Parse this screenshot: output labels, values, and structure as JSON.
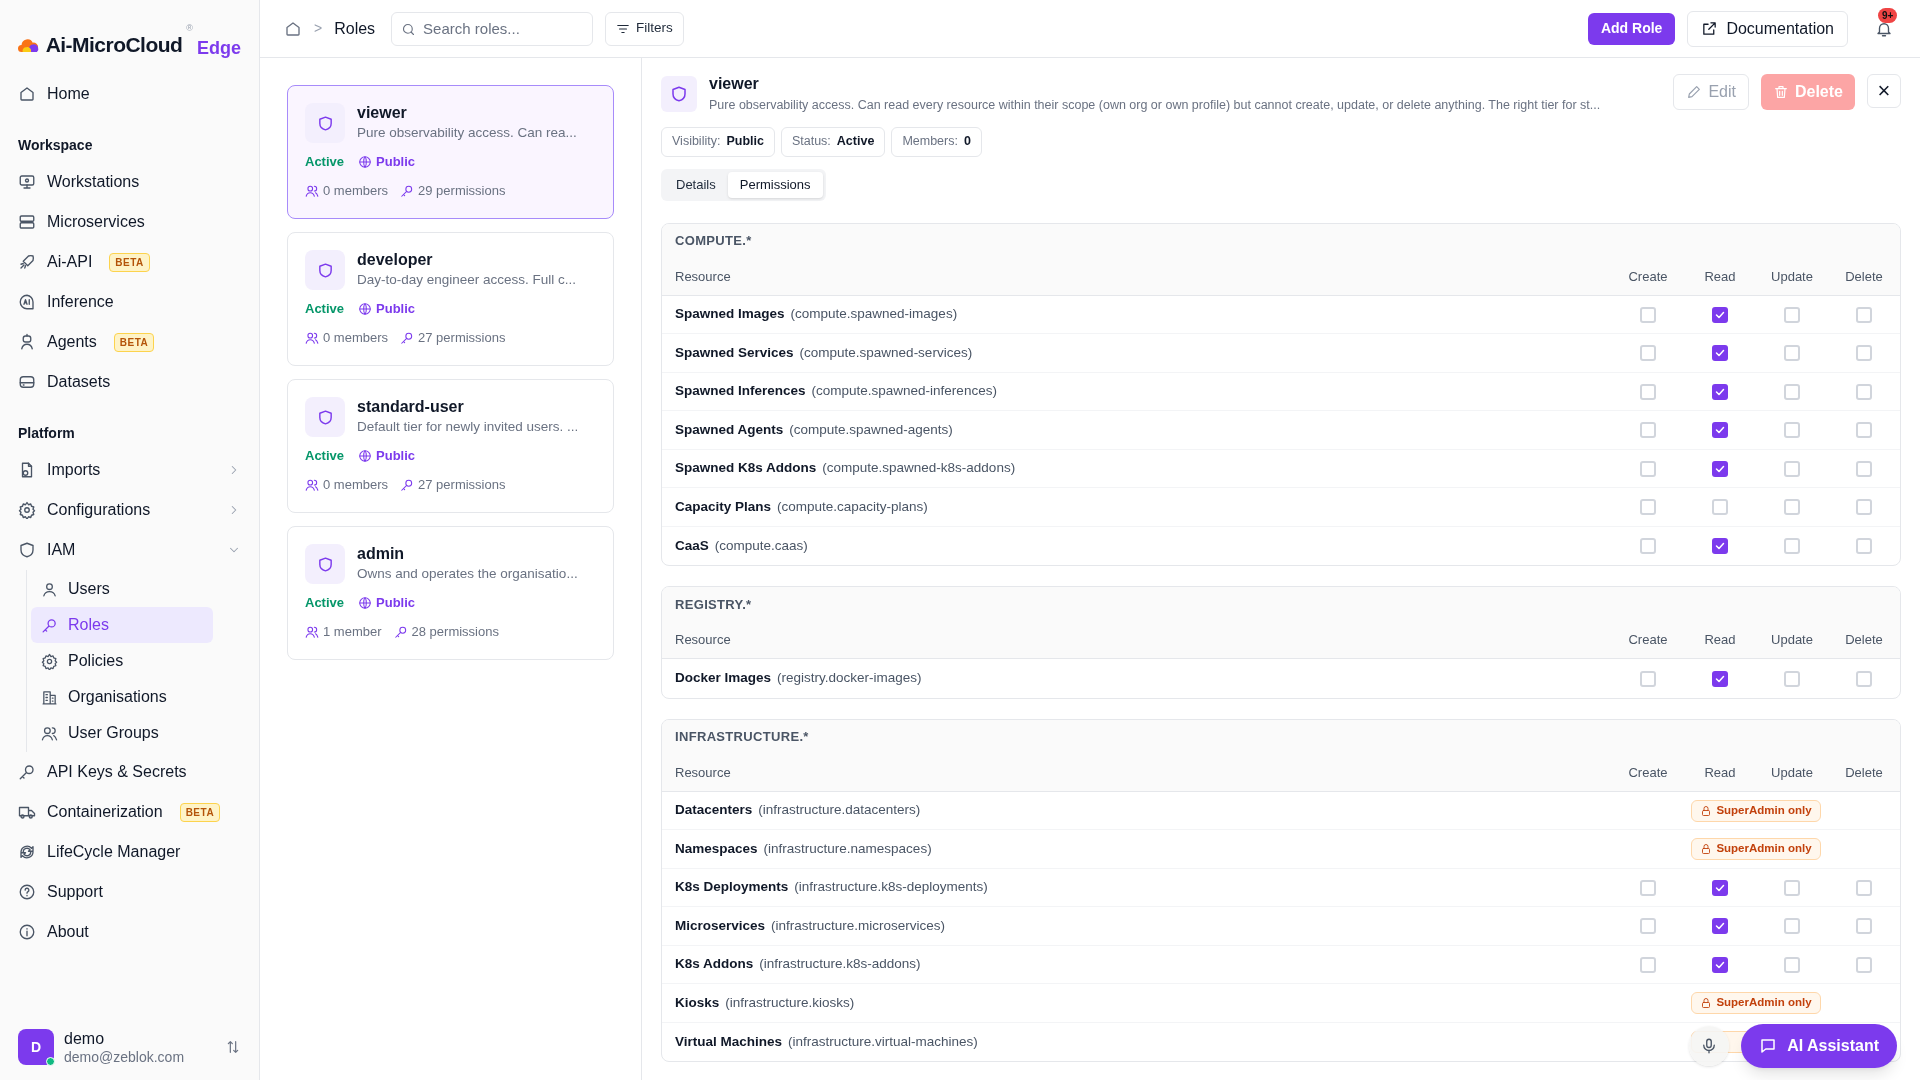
{
  "sidebar": {
    "brand": {
      "name": "Ai-MicroCloud",
      "mark": "®",
      "edition": "Edge"
    },
    "nav": [
      {
        "kind": "item",
        "label": "Home",
        "selected": false
      },
      {
        "kind": "section",
        "label": "Workspace"
      },
      {
        "kind": "item",
        "label": "Workstations",
        "selected": false
      },
      {
        "kind": "item",
        "label": "Microservices",
        "selected": false
      },
      {
        "kind": "item",
        "label": "Ai-API",
        "badge": "BETA",
        "selected": false
      },
      {
        "kind": "item",
        "label": "Inference",
        "selected": false
      },
      {
        "kind": "item",
        "label": "Agents",
        "badge": "BETA",
        "selected": false
      },
      {
        "kind": "item",
        "label": "Datasets",
        "selected": false
      },
      {
        "kind": "section",
        "label": "Platform"
      },
      {
        "kind": "group",
        "label": "Imports",
        "expanded": false
      },
      {
        "kind": "group",
        "label": "Configurations",
        "expanded": false
      },
      {
        "kind": "group",
        "label": "IAM",
        "expanded": true,
        "children": [
          {
            "label": "Users",
            "selected": false
          },
          {
            "label": "Roles",
            "selected": true
          },
          {
            "label": "Policies",
            "selected": false
          },
          {
            "label": "Organisations",
            "selected": false
          },
          {
            "label": "User Groups",
            "selected": false
          }
        ]
      },
      {
        "kind": "item",
        "label": "API Keys & Secrets",
        "selected": false
      },
      {
        "kind": "item",
        "label": "Containerization",
        "badge": "BETA",
        "selected": false
      },
      {
        "kind": "item",
        "label": "LifeCycle Manager",
        "selected": false
      },
      {
        "kind": "item",
        "label": "Support",
        "selected": false
      },
      {
        "kind": "item",
        "label": "About",
        "selected": false
      }
    ],
    "user": {
      "initial": "D",
      "name": "demo",
      "email": "demo@zeblok.com",
      "online": true
    }
  },
  "header": {
    "breadcrumb": ">",
    "page": "Roles",
    "search": {
      "placeholder": "Search roles..."
    },
    "filters": "Filters",
    "add_button": "Add Role",
    "docs_button": "Documentation",
    "notifications": "9+"
  },
  "roles": [
    {
      "name": "viewer",
      "description": "Pure observability access. Can rea...",
      "status": "Active",
      "visibility": "Public",
      "members": "0 members",
      "permissions": "29 permissions",
      "selected": true
    },
    {
      "name": "developer",
      "description": "Day-to-day engineer access. Full c...",
      "status": "Active",
      "visibility": "Public",
      "members": "0 members",
      "permissions": "27 permissions",
      "selected": false
    },
    {
      "name": "standard-user",
      "description": "Default tier for newly invited users. ...",
      "status": "Active",
      "visibility": "Public",
      "members": "0 members",
      "permissions": "27 permissions",
      "selected": false
    },
    {
      "name": "admin",
      "description": "Owns and operates the organisatio...",
      "status": "Active",
      "visibility": "Public",
      "members": "1 member",
      "permissions": "28 permissions",
      "selected": false
    }
  ],
  "detail": {
    "title": "viewer",
    "description": "Pure observability access. Can read every resource within their scope (own org or own profile) but cannot create, update, or delete anything. The right tier for st...",
    "edit": {
      "label": "Edit",
      "disabled": true
    },
    "delete": {
      "label": "Delete",
      "disabled": true
    },
    "close": "×",
    "chips": [
      {
        "label": "Visibility:",
        "value": "Public"
      },
      {
        "label": "Status:",
        "value": "Active"
      },
      {
        "label": "Members:",
        "value": "0"
      }
    ],
    "tabs": [
      {
        "label": "Details",
        "selected": false
      },
      {
        "label": "Permissions",
        "selected": true
      }
    ]
  },
  "permissions": [
    {
      "title": "COMPUTE.*",
      "columns": [
        "Resource",
        "Create",
        "Read",
        "Update",
        "Delete"
      ],
      "rows": [
        {
          "kind": "checks",
          "name": "Spawned Images",
          "key": "(compute.spawned-images)",
          "create": false,
          "read": true,
          "update": false,
          "delete": false
        },
        {
          "kind": "checks",
          "name": "Spawned Services",
          "key": "(compute.spawned-services)",
          "create": false,
          "read": true,
          "update": false,
          "delete": false
        },
        {
          "kind": "checks",
          "name": "Spawned Inferences",
          "key": "(compute.spawned-inferences)",
          "create": false,
          "read": true,
          "update": false,
          "delete": false
        },
        {
          "kind": "checks",
          "name": "Spawned Agents",
          "key": "(compute.spawned-agents)",
          "create": false,
          "read": true,
          "update": false,
          "delete": false
        },
        {
          "kind": "checks",
          "name": "Spawned K8s Addons",
          "key": "(compute.spawned-k8s-addons)",
          "create": false,
          "read": true,
          "update": false,
          "delete": false
        },
        {
          "kind": "checks",
          "name": "Capacity Plans",
          "key": "(compute.capacity-plans)",
          "create": false,
          "read": false,
          "update": false,
          "delete": false
        },
        {
          "kind": "checks",
          "name": "CaaS",
          "key": "(compute.caas)",
          "create": false,
          "read": true,
          "update": false,
          "delete": false
        }
      ]
    },
    {
      "title": "REGISTRY.*",
      "columns": [
        "Resource",
        "Create",
        "Read",
        "Update",
        "Delete"
      ],
      "rows": [
        {
          "kind": "checks",
          "name": "Docker Images",
          "key": "(registry.docker-images)",
          "create": false,
          "read": true,
          "update": false,
          "delete": false
        }
      ]
    },
    {
      "title": "INFRASTRUCTURE.*",
      "columns": [
        "Resource",
        "Create",
        "Read",
        "Update",
        "Delete"
      ],
      "rows": [
        {
          "kind": "restricted",
          "name": "Datacenters",
          "key": "(infrastructure.datacenters)",
          "badge": "SuperAdmin only"
        },
        {
          "kind": "restricted",
          "name": "Namespaces",
          "key": "(infrastructure.namespaces)",
          "badge": "SuperAdmin only"
        },
        {
          "kind": "checks",
          "name": "K8s Deployments",
          "key": "(infrastructure.k8s-deployments)",
          "create": false,
          "read": true,
          "update": false,
          "delete": false
        },
        {
          "kind": "checks",
          "name": "Microservices",
          "key": "(infrastructure.microservices)",
          "create": false,
          "read": true,
          "update": false,
          "delete": false
        },
        {
          "kind": "checks",
          "name": "K8s Addons",
          "key": "(infrastructure.k8s-addons)",
          "create": false,
          "read": true,
          "update": false,
          "delete": false
        },
        {
          "kind": "restricted",
          "name": "Kiosks",
          "key": "(infrastructure.kiosks)",
          "badge": "SuperAdmin only"
        },
        {
          "kind": "restricted",
          "name": "Virtual Machines",
          "key": "(infrastructure.virtual-machines)"
        }
      ]
    }
  ],
  "assistant": {
    "label": "AI Assistant"
  }
}
